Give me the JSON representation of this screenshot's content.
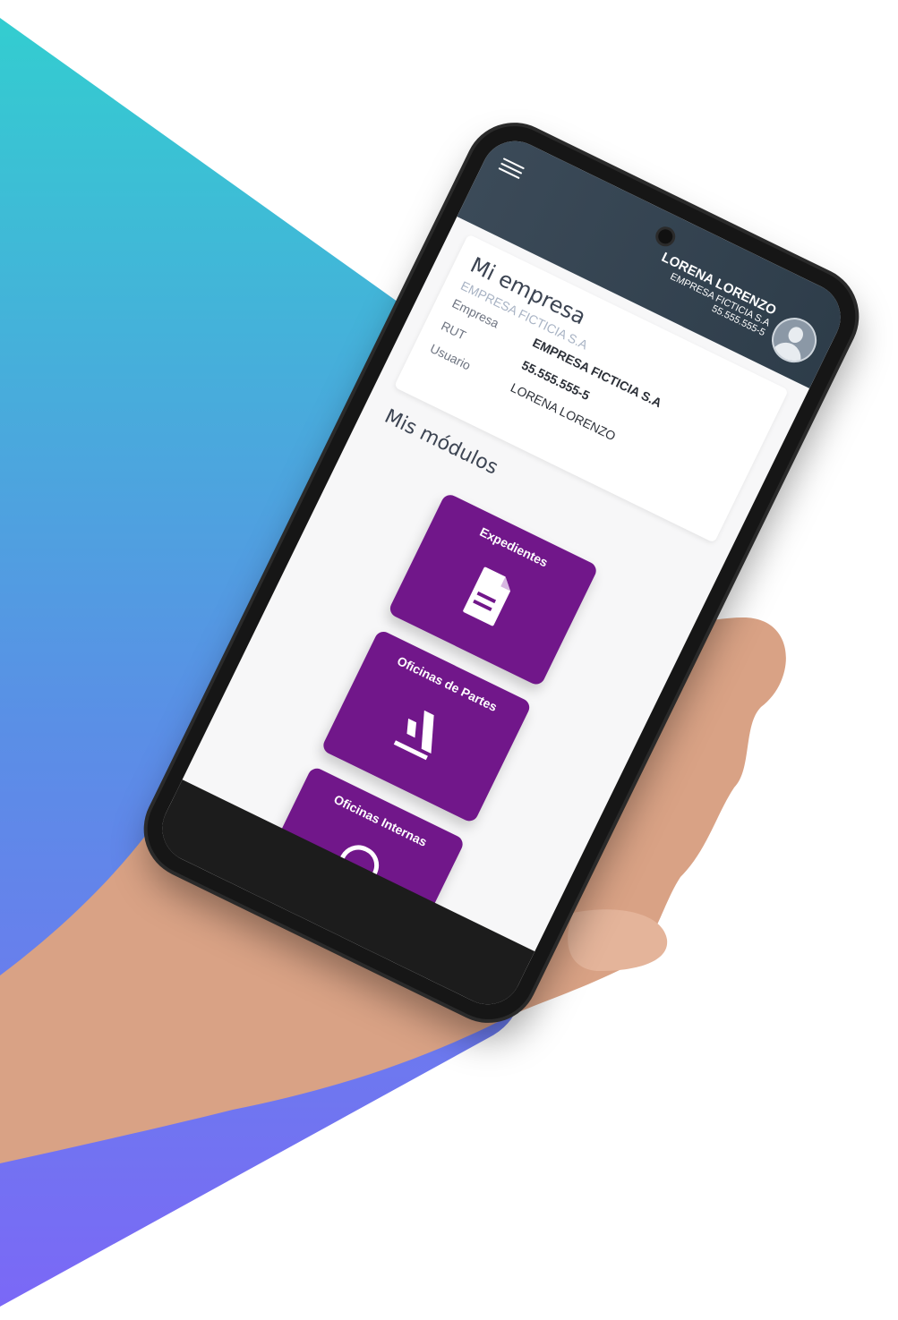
{
  "colors": {
    "accent": "#71178a",
    "topbar": "#2e3d4a",
    "gradient_top": "#33cdd0",
    "gradient_bottom": "#7b68f6"
  },
  "header": {
    "menu_icon": "hamburger-icon",
    "user_name": "LORENA LORENZO",
    "user_company": "EMPRESA FICTICIA S.A",
    "user_rut": "55.555.555-5",
    "avatar_icon": "user-avatar-icon"
  },
  "company_card": {
    "title": "Mi empresa",
    "subtitle": "EMPRESA FICTICIA S.A",
    "rows": [
      {
        "label": "Empresa",
        "value": "EMPRESA FICTICIA S.A"
      },
      {
        "label": "RUT",
        "value": "55.555.555-5"
      },
      {
        "label": "Usuario",
        "value": "LORENA LORENZO"
      }
    ]
  },
  "modules_section": {
    "title": "Mis módulos",
    "modules": [
      {
        "label": "Expedientes",
        "icon": "document-icon"
      },
      {
        "label": "Oficinas de Partes",
        "icon": "gavel-icon"
      },
      {
        "label": "Oficinas Internas",
        "icon": "location-pin-icon"
      }
    ]
  }
}
